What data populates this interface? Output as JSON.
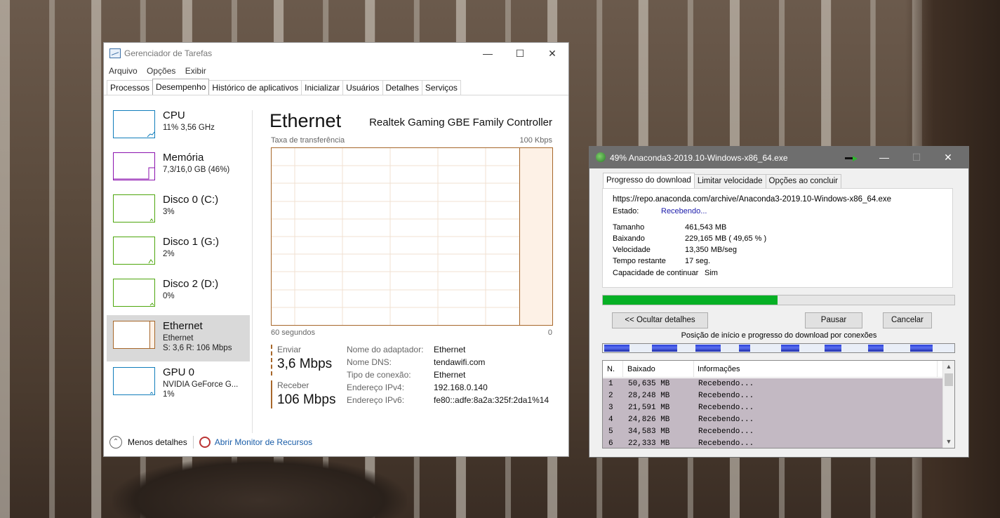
{
  "taskmanager": {
    "title": "Gerenciador de Tarefas",
    "menu": [
      "Arquivo",
      "Opções",
      "Exibir"
    ],
    "tabs": [
      "Processos",
      "Desempenho",
      "Histórico de aplicativos",
      "Inicializar",
      "Usuários",
      "Detalhes",
      "Serviços"
    ],
    "active_tab": "Desempenho",
    "sidebar": [
      {
        "title": "CPU",
        "sub": "11% 3,56 GHz",
        "color": "#117dbb"
      },
      {
        "title": "Memória",
        "sub": "7,3/16,0 GB (46%)",
        "color": "#8b12ae"
      },
      {
        "title": "Disco 0 (C:)",
        "sub": "3%",
        "color": "#4da60c"
      },
      {
        "title": "Disco 1 (G:)",
        "sub": "2%",
        "color": "#4da60c"
      },
      {
        "title": "Disco 2 (D:)",
        "sub": "0%",
        "color": "#4da60c"
      },
      {
        "title": "Ethernet",
        "sub": "Ethernet",
        "sub2": "S: 3,6 R: 106 Mbps",
        "color": "#a7672a"
      },
      {
        "title": "GPU 0",
        "sub": "NVIDIA GeForce G...",
        "sub2": "1%",
        "color": "#117dbb"
      }
    ],
    "main": {
      "title": "Ethernet",
      "adapter": "Realtek Gaming GBE Family Controller",
      "graph_label": "Taxa de transferência",
      "graph_max": "100 Kbps",
      "graph_time": "60 segundos",
      "graph_min": "0",
      "send_label": "Enviar",
      "send_value": "3,6 Mbps",
      "recv_label": "Receber",
      "recv_value": "106 Mbps",
      "info": [
        {
          "k": "Nome do adaptador:",
          "v": "Ethernet"
        },
        {
          "k": "Nome DNS:",
          "v": "tendawifi.com"
        },
        {
          "k": "Tipo de conexão:",
          "v": "Ethernet"
        },
        {
          "k": "Endereço IPv4:",
          "v": "192.168.0.140"
        },
        {
          "k": "Endereço IPv6:",
          "v": "fe80::adfe:8a2a:325f:2da1%14"
        }
      ]
    },
    "footer": {
      "less": "Menos detalhes",
      "resmon": "Abrir Monitor de Recursos"
    }
  },
  "idm": {
    "title": "49% Anaconda3-2019.10-Windows-x86_64.exe",
    "tabs": [
      "Progresso do download",
      "Limitar velocidade",
      "Opções ao concluir"
    ],
    "url": "https://repo.anaconda.com/archive/Anaconda3-2019.10-Windows-x86_64.exe",
    "state_label": "Estado:",
    "state_value": "Recebendo...",
    "fields": [
      {
        "k": "Tamanho",
        "v": "461,543  MB"
      },
      {
        "k": "Baixando",
        "v": "229,165  MB  ( 49,65 % )"
      },
      {
        "k": "Velocidade",
        "v": "13,350  MB/seg"
      },
      {
        "k": "Tempo restante",
        "v": "17 seg."
      }
    ],
    "resume_label": "Capacidade de continuar",
    "resume_value": "Sim",
    "progress": 0.4965,
    "buttons": {
      "details": "<< Ocultar detalhes",
      "pause": "Pausar",
      "cancel": "Cancelar"
    },
    "caption": "Posição de início e progresso do download por conexões",
    "columns": [
      "N.",
      "Baixado",
      "Informações"
    ],
    "connections": [
      {
        "n": "1",
        "size": "50,635 MB",
        "info": "Recebendo..."
      },
      {
        "n": "2",
        "size": "28,248 MB",
        "info": "Recebendo..."
      },
      {
        "n": "3",
        "size": "21,591 MB",
        "info": "Recebendo..."
      },
      {
        "n": "4",
        "size": "24,826 MB",
        "info": "Recebendo..."
      },
      {
        "n": "5",
        "size": "34,583 MB",
        "info": "Recebendo..."
      },
      {
        "n": "6",
        "size": "22,333 MB",
        "info": "Recebendo..."
      }
    ]
  }
}
